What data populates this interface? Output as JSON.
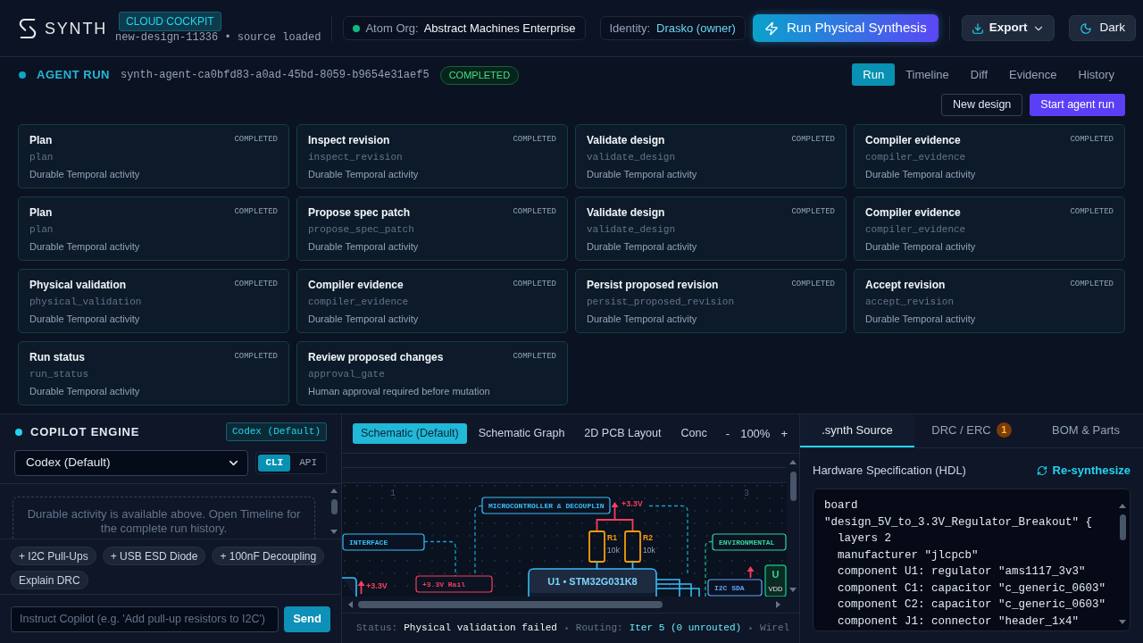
{
  "header": {
    "brand": "SYNTH",
    "badge": "CLOUD COCKPIT",
    "subtitle": "new-design-11336 • source loaded",
    "org": {
      "label": "Atom Org:",
      "value": "Abstract Machines Enterprise"
    },
    "identity": {
      "label": "Identity:",
      "value": "Drasko (owner)"
    },
    "primary_action": "Run Physical Synthesis",
    "export_button": "Export",
    "theme_button": "Dark"
  },
  "run": {
    "title": "AGENT RUN",
    "run_id": "synth-agent-ca0bfd83-a0ad-45bd-8059-b9654e31aef5",
    "status": "COMPLETED",
    "tabs": [
      {
        "label": "Run",
        "selected": true
      },
      {
        "label": "Timeline",
        "selected": false
      },
      {
        "label": "Diff",
        "selected": false
      },
      {
        "label": "Evidence",
        "selected": false
      },
      {
        "label": "History",
        "selected": false
      }
    ],
    "buttons": [
      {
        "label": "New design",
        "kind": "outline"
      },
      {
        "label": "Start agent run",
        "kind": "primary"
      }
    ]
  },
  "activities": [
    {
      "title": "Plan",
      "status": "COMPLETED",
      "id": "plan",
      "description": "Durable Temporal activity"
    },
    {
      "title": "Inspect revision",
      "status": "COMPLETED",
      "id": "inspect_revision",
      "description": "Durable Temporal activity"
    },
    {
      "title": "Validate design",
      "status": "COMPLETED",
      "id": "validate_design",
      "description": "Durable Temporal activity"
    },
    {
      "title": "Compiler evidence",
      "status": "COMPLETED",
      "id": "compiler_evidence",
      "description": "Durable Temporal activity"
    },
    {
      "title": "Plan",
      "status": "COMPLETED",
      "id": "plan",
      "description": "Durable Temporal activity"
    },
    {
      "title": "Propose spec patch",
      "status": "COMPLETED",
      "id": "propose_spec_patch",
      "description": "Durable Temporal activity"
    },
    {
      "title": "Validate design",
      "status": "COMPLETED",
      "id": "validate_design",
      "description": "Durable Temporal activity"
    },
    {
      "title": "Compiler evidence",
      "status": "COMPLETED",
      "id": "compiler_evidence",
      "description": "Durable Temporal activity"
    },
    {
      "title": "Physical validation",
      "status": "COMPLETED",
      "id": "physical_validation",
      "description": "Durable Temporal activity"
    },
    {
      "title": "Compiler evidence",
      "status": "COMPLETED",
      "id": "compiler_evidence",
      "description": "Durable Temporal activity"
    },
    {
      "title": "Persist proposed revision",
      "status": "COMPLETED",
      "id": "persist_proposed_revision",
      "description": "Durable Temporal activity"
    },
    {
      "title": "Accept revision",
      "status": "COMPLETED",
      "id": "accept_revision",
      "description": "Durable Temporal activity"
    },
    {
      "title": "Run status",
      "status": "COMPLETED",
      "id": "run_status",
      "description": "Durable Temporal activity"
    },
    {
      "title": "Review proposed changes",
      "status": "COMPLETED",
      "id": "approval_gate",
      "description": "Human approval required before mutation"
    }
  ],
  "copilot": {
    "title": "COPILOT ENGINE",
    "engine_badge": "Codex (Default)",
    "engine_select": "Codex (Default)",
    "modes": [
      {
        "label": "CLI",
        "selected": true
      },
      {
        "label": "API",
        "selected": false
      }
    ],
    "notice": "Durable activity is available above. Open Timeline for the complete run history.",
    "suggestions": [
      "+ I2C Pull-Ups",
      "+ USB ESD Diode",
      "+ 100nF Decoupling",
      "Explain DRC"
    ],
    "input": {
      "placeholder": "Instruct Copilot (e.g. 'Add pull-up resistors to I2C')"
    },
    "send_button": "Send"
  },
  "viewer": {
    "tabs": [
      {
        "label": "Schematic (Default)",
        "selected": true
      },
      {
        "label": "Schematic Graph",
        "selected": false
      },
      {
        "label": "2D PCB Layout",
        "selected": false
      },
      {
        "label": "Conc",
        "selected": false
      }
    ],
    "zoom": {
      "out": "-",
      "level": "100%",
      "in": "+"
    },
    "schematic": {
      "zone_markers": [
        "1",
        "3"
      ],
      "blocks": [
        {
          "label": "MICROCONTROLLER & DECOUPLIN",
          "color": "#38bdf8"
        },
        {
          "label": "INTERFACE",
          "color": "#38bdf8"
        },
        {
          "label": "ENVIRONMENTAL",
          "color": "#34d399"
        },
        {
          "label": "+3.3V Rail",
          "color": "#f43f5e"
        },
        {
          "label": "I2C SDA",
          "color": "#60a5fa"
        }
      ],
      "power_flags": [
        "+3.3V",
        "+3.3V"
      ],
      "resistors": [
        {
          "ref": "R1",
          "value": "10k"
        },
        {
          "ref": "R2",
          "value": "10k"
        }
      ],
      "chip": "U1 • STM32G031K8",
      "part": {
        "ref": "U",
        "pin": "VDD"
      }
    },
    "status_bar": [
      {
        "label": "Status:",
        "value": "Physical validation failed",
        "kind": "plain"
      },
      {
        "label": "Routing:",
        "value": "Iter 5 (0 unrouted)",
        "kind": "accent"
      },
      {
        "label": "Wirel"
      }
    ]
  },
  "source": {
    "tabs": [
      {
        "label": ".synth Source",
        "selected": true
      },
      {
        "label": "DRC / ERC",
        "selected": false,
        "badge": "1"
      },
      {
        "label": "BOM & Parts",
        "selected": false
      }
    ],
    "title": "Hardware Specification (HDL)",
    "action": "Re-synthesize",
    "code": [
      "board",
      "\"design_5V_to_3.3V_Regulator_Breakout\" {",
      "  layers 2",
      "  manufacturer \"jlcpcb\"",
      "  component U1: regulator \"ams1117_3v3\"",
      "  component C1: capacitor \"c_generic_0603\"",
      "  component C2: capacitor \"c_generic_0603\"",
      "  component J1: connector \"header_1x4\""
    ]
  }
}
